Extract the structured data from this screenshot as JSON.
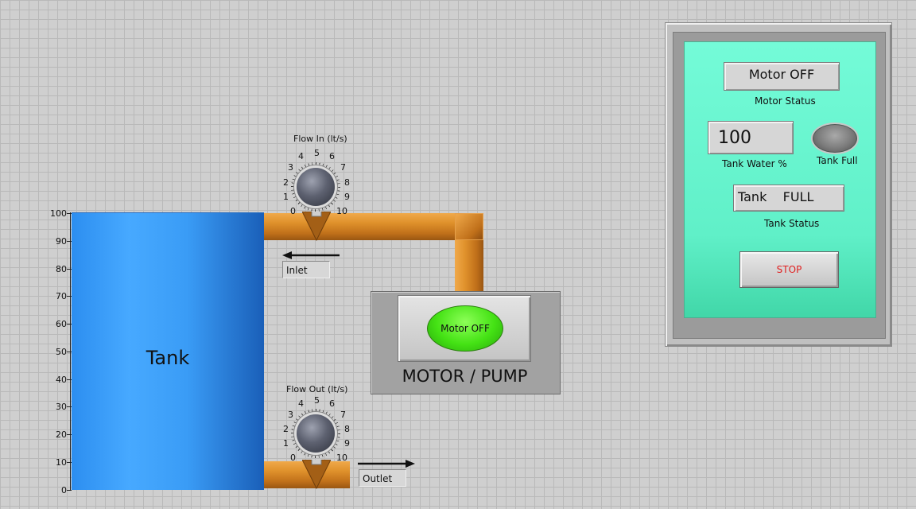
{
  "tank": {
    "label": "Tank",
    "scale_labels": [
      "100",
      "90",
      "80",
      "70",
      "60",
      "50",
      "40",
      "30",
      "20",
      "10",
      "0"
    ],
    "fill_percent": 100
  },
  "flow_in": {
    "title": "Flow In (lt/s)",
    "numbers": [
      "0",
      "1",
      "2",
      "3",
      "4",
      "5",
      "6",
      "7",
      "8",
      "9",
      "10"
    ],
    "value": 0
  },
  "flow_out": {
    "title": "Flow Out (lt/s)",
    "numbers": [
      "0",
      "1",
      "2",
      "3",
      "4",
      "5",
      "6",
      "7",
      "8",
      "9",
      "10"
    ],
    "value": 0
  },
  "labels": {
    "inlet": "Inlet",
    "outlet": "Outlet"
  },
  "motor": {
    "button_label": "Motor OFF",
    "title": "MOTOR / PUMP",
    "button_color": "#44e214"
  },
  "status_panel": {
    "motor_status_value": "Motor OFF",
    "motor_status_caption": "Motor Status",
    "tank_water_value": "100",
    "tank_water_caption": "Tank Water %",
    "tank_full_caption": "Tank Full",
    "tank_status_value": "Tank    FULL",
    "tank_status_caption": "Tank Status",
    "stop_label": "STOP",
    "panel_color": "#60f0c8",
    "stop_color": "#e02020"
  }
}
